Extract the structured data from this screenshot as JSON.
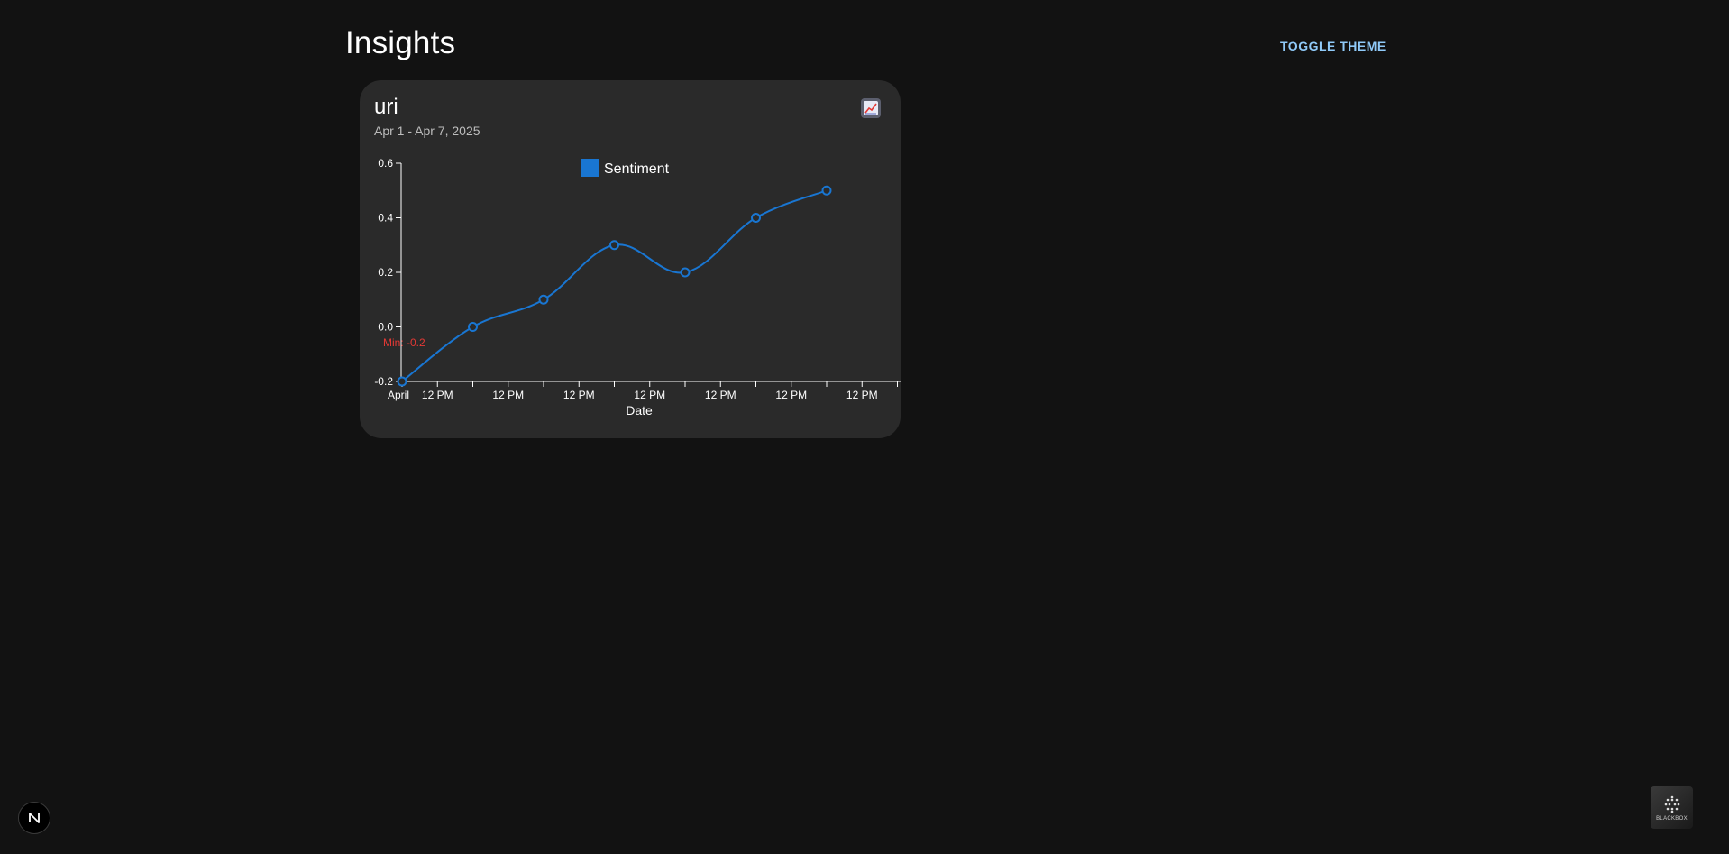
{
  "page": {
    "title": "Insights"
  },
  "header": {
    "toggle_label": "Toggle theme"
  },
  "card": {
    "title": "uri",
    "subtitle": "Apr 1 - Apr 7, 2025",
    "chart_icon": "chart-line-icon"
  },
  "chart_data": {
    "type": "line",
    "title": "",
    "xlabel": "Date",
    "ylabel": "",
    "legend": {
      "entries": [
        "Sentiment"
      ],
      "placement": "top-center"
    },
    "x": [
      "2025-04-01",
      "2025-04-02",
      "2025-04-03",
      "2025-04-04",
      "2025-04-05",
      "2025-04-06",
      "2025-04-07"
    ],
    "series": [
      {
        "name": "Sentiment",
        "values": [
          -0.2,
          0.0,
          0.1,
          0.3,
          0.2,
          0.4,
          0.5
        ],
        "color": "#1976d2"
      }
    ],
    "ylim": [
      -0.2,
      0.6
    ],
    "y_ticks": [
      "-0.2",
      "0.0",
      "0.2",
      "0.4",
      "0.6"
    ],
    "x_tick_labels": [
      "April",
      "12 PM",
      "12 PM",
      "12 PM",
      "12 PM",
      "12 PM",
      "12 PM",
      "12 PM"
    ],
    "annotation": {
      "text": "Min: -0.2",
      "color": "#e53935"
    },
    "grid": false
  },
  "footer": {
    "next_badge_icon": "next-logo-icon",
    "brand_logo_text": "BLACKBOX"
  }
}
